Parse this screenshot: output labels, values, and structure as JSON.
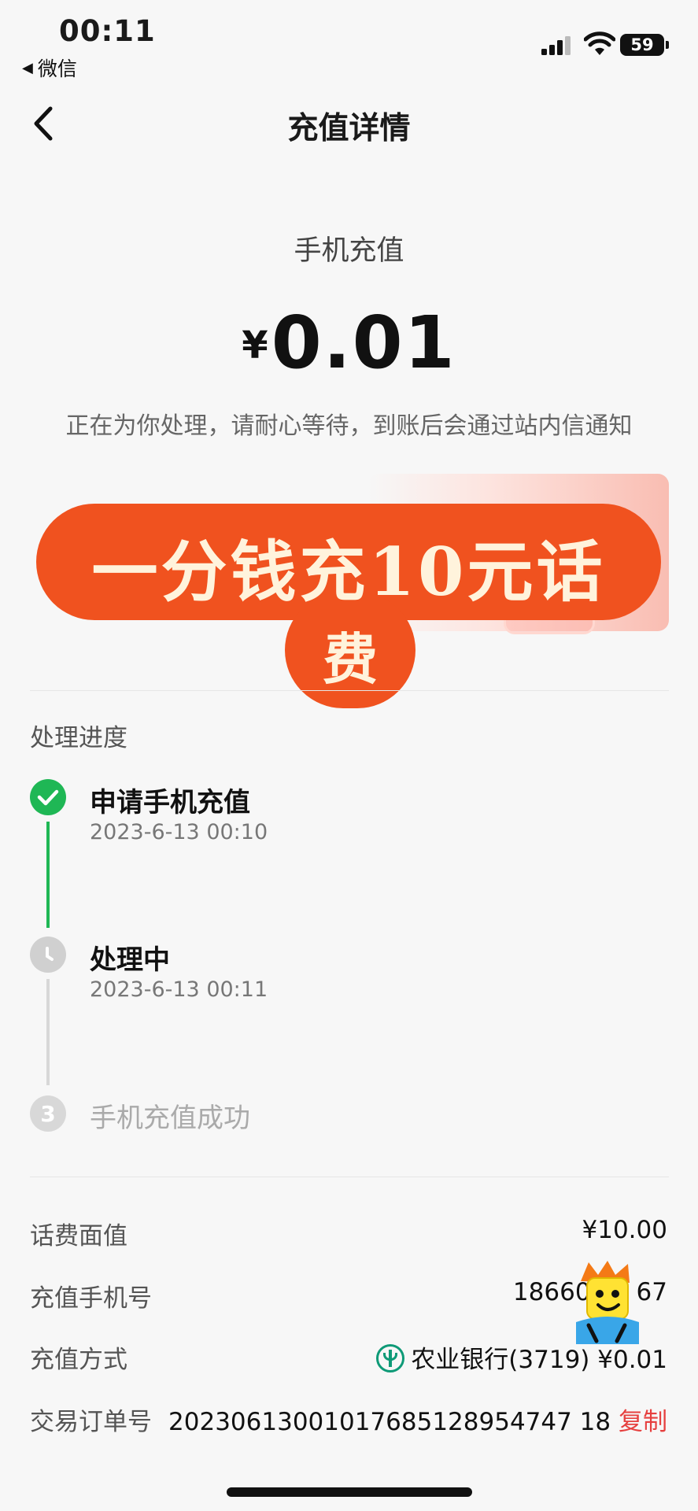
{
  "status_bar": {
    "time": "00:11",
    "back_app": "微信",
    "battery": "59"
  },
  "nav": {
    "title": "充值详情"
  },
  "summary": {
    "category": "手机充值",
    "currency": "¥",
    "amount": "0.01",
    "notice": "正在为你处理，请耐心等待，到账后会通过站内信通知"
  },
  "promo": {
    "line1": "一分钱充10元话",
    "line2": "费"
  },
  "progress": {
    "title": "处理进度",
    "steps": [
      {
        "label": "申请手机充值",
        "time": "2023-6-13 00:10",
        "state": "done"
      },
      {
        "label": "处理中",
        "time": "2023-6-13 00:11",
        "state": "processing"
      },
      {
        "label": "手机充值成功",
        "number": "3",
        "state": "pending"
      }
    ]
  },
  "details": {
    "face_value_label": "话费面值",
    "face_value": "¥10.00",
    "phone_label": "充值手机号",
    "phone": "18660",
    "phone_tail": "67",
    "method_label": "充值方式",
    "method": "农业银行(3719) ¥0.01",
    "order_label": "交易订单号",
    "order_no": "20230613001017685128954747 18",
    "copy": "复制"
  },
  "colors": {
    "success": "#1fb755",
    "promo": "#f0521f",
    "link": "#e6403f",
    "bank": "#0e9a77"
  }
}
